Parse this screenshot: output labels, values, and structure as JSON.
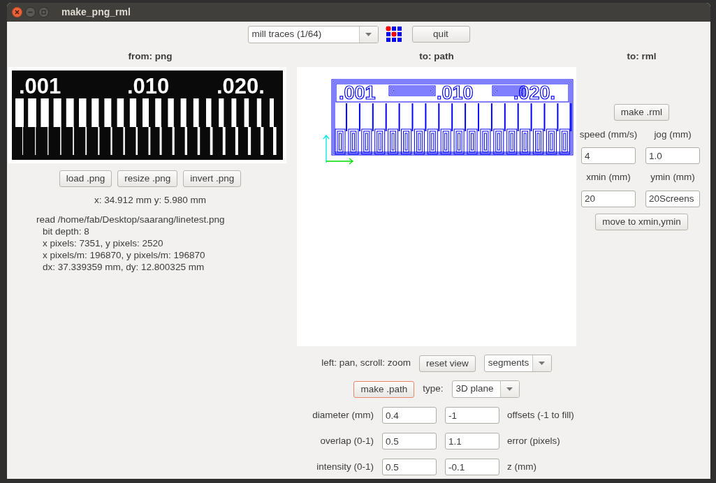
{
  "window": {
    "title": "make_png_rml"
  },
  "toolbar": {
    "process": {
      "value": "mill traces (1/64)"
    },
    "quit": "quit"
  },
  "from_png": {
    "heading": "from: png",
    "preview_labels": [
      ".001",
      ".010",
      ".020."
    ],
    "buttons": [
      "load .png",
      "resize .png",
      "invert .png"
    ],
    "coordinates": "x: 34.912 mm  y: 5.980 mm",
    "info": {
      "title": "read /home/fab/Desktop/saarang/linetest.png",
      "lines": [
        "bit depth: 8",
        "x pixels: 7351, y pixels: 2520",
        "x pixels/m: 196870, y pixels/m: 196870",
        "dx: 37.339359 mm, dy: 12.800325 mm"
      ]
    }
  },
  "to_path": {
    "heading": "to: path",
    "path_labels": [
      ".001",
      ".010",
      ".020."
    ],
    "view_hint": "left: pan, scroll: zoom",
    "reset": "reset view",
    "display": {
      "value": "segments"
    },
    "make_button": {
      "label": "make .path",
      "focused": true
    },
    "type_label": "type:",
    "type": {
      "value": "3D plane"
    },
    "params": [
      {
        "label": "diameter (mm)",
        "value": "0.4",
        "value2": "-1",
        "label2": "offsets (-1 to fill)"
      },
      {
        "label": "overlap (0-1)",
        "value": "0.5",
        "value2": "1.1",
        "label2": "error (pixels)"
      },
      {
        "label": "intensity (0-1)",
        "value": "0.5",
        "value2": "-0.1",
        "label2": "z (mm)"
      }
    ]
  },
  "to_rml": {
    "heading": "to: rml",
    "make_button": "make .rml",
    "fields": [
      {
        "label": "speed (mm/s)",
        "value": "4"
      },
      {
        "label": "jog (mm)",
        "value": "1.0"
      },
      {
        "label": "xmin (mm)",
        "value": "20"
      },
      {
        "label": "ymin (mm)",
        "value": "20Screens"
      }
    ],
    "move_button": "move to xmin,ymin"
  }
}
